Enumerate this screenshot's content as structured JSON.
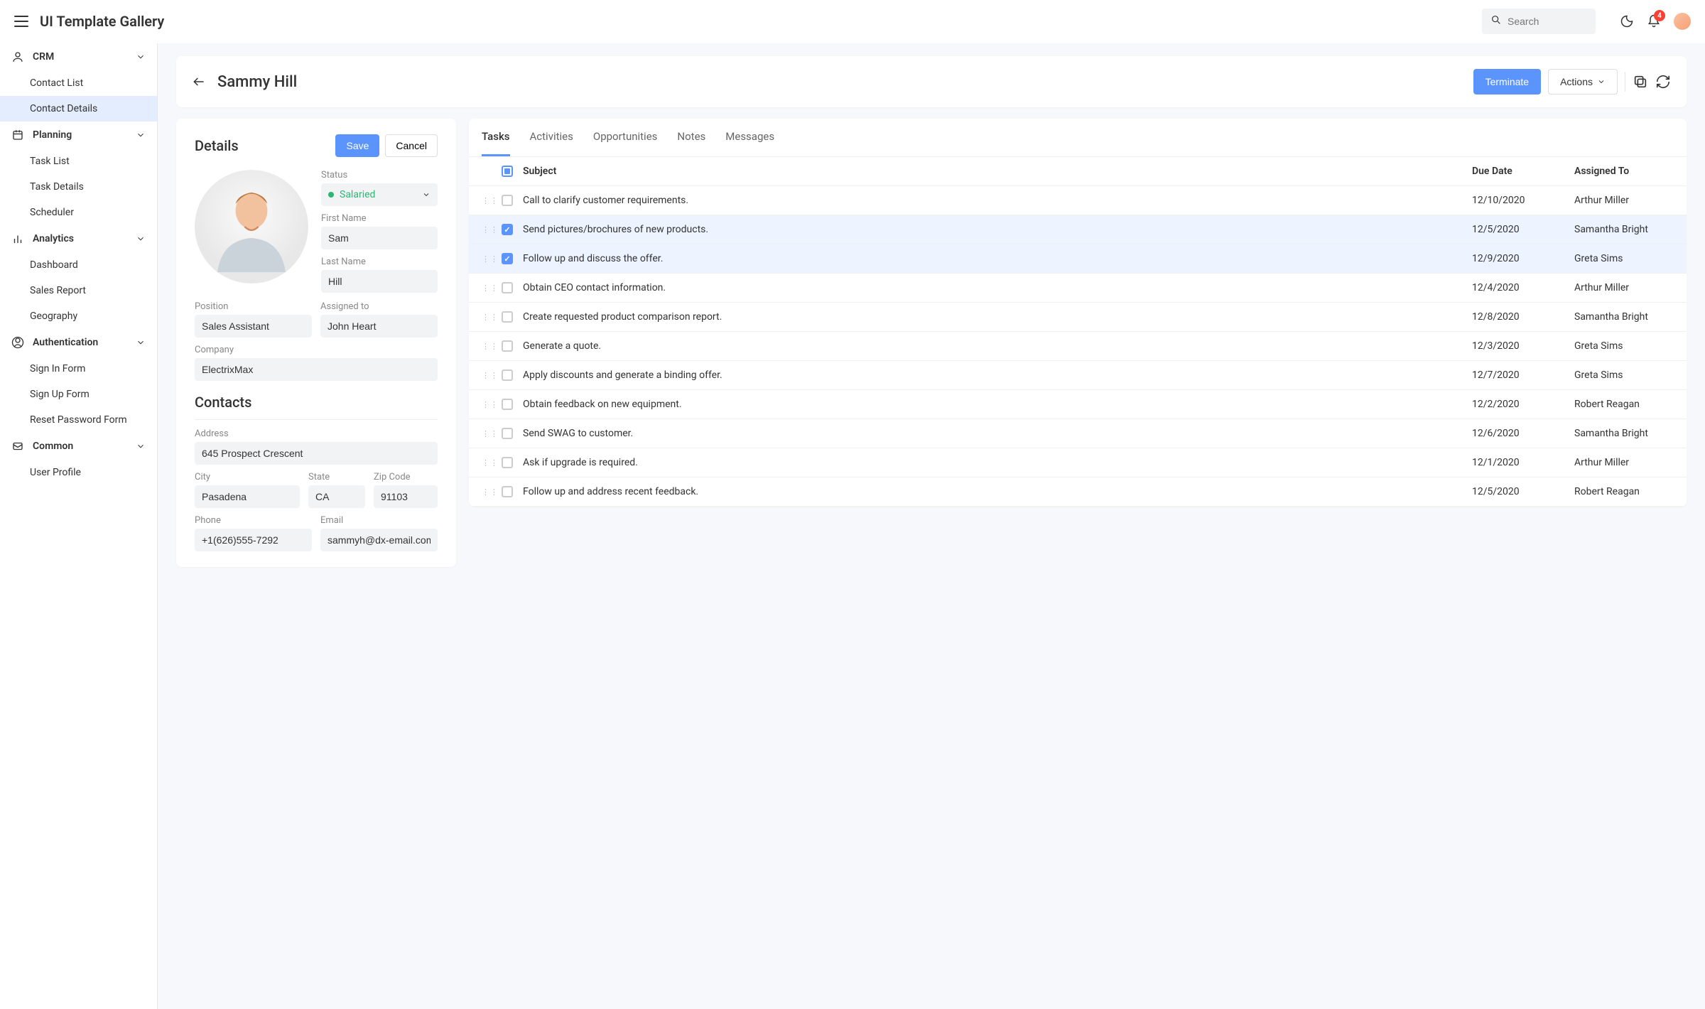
{
  "header": {
    "app_title": "UI Template Gallery",
    "search_placeholder": "Search",
    "notification_count": "4"
  },
  "sidebar": [
    {
      "title": "CRM",
      "items": [
        "Contact List",
        "Contact Details"
      ],
      "active_item": "Contact Details"
    },
    {
      "title": "Planning",
      "items": [
        "Task List",
        "Task Details",
        "Scheduler"
      ]
    },
    {
      "title": "Analytics",
      "items": [
        "Dashboard",
        "Sales Report",
        "Geography"
      ]
    },
    {
      "title": "Authentication",
      "items": [
        "Sign In Form",
        "Sign Up Form",
        "Reset Password Form"
      ]
    },
    {
      "title": "Common",
      "items": [
        "User Profile"
      ]
    }
  ],
  "titlebar": {
    "page_name": "Sammy Hill",
    "terminate": "Terminate",
    "actions": "Actions"
  },
  "details": {
    "title": "Details",
    "save": "Save",
    "cancel": "Cancel",
    "labels": {
      "status": "Status",
      "first_name": "First Name",
      "last_name": "Last Name",
      "position": "Position",
      "assigned_to": "Assigned to",
      "company": "Company",
      "contacts_section": "Contacts",
      "address": "Address",
      "city": "City",
      "state": "State",
      "zip": "Zip Code",
      "phone": "Phone",
      "email": "Email"
    },
    "values": {
      "status": "Salaried",
      "first_name": "Sam",
      "last_name": "Hill",
      "position": "Sales Assistant",
      "assigned_to": "John Heart",
      "company": "ElectrixMax",
      "address": "645 Prospect Crescent",
      "city": "Pasadena",
      "state": "CA",
      "zip": "91103",
      "phone": "+1(626)555-7292",
      "email": "sammyh@dx-email.com"
    }
  },
  "tabs": [
    "Tasks",
    "Activities",
    "Opportunities",
    "Notes",
    "Messages"
  ],
  "active_tab": "Tasks",
  "tasks": {
    "columns": {
      "subject": "Subject",
      "due": "Due Date",
      "assigned": "Assigned To"
    },
    "rows": [
      {
        "checked": false,
        "subject": "Call to clarify customer requirements.",
        "due": "12/10/2020",
        "assigned": "Arthur Miller"
      },
      {
        "checked": true,
        "subject": "Send pictures/brochures of new products.",
        "due": "12/5/2020",
        "assigned": "Samantha Bright"
      },
      {
        "checked": true,
        "subject": "Follow up and discuss the offer.",
        "due": "12/9/2020",
        "assigned": "Greta Sims"
      },
      {
        "checked": false,
        "subject": "Obtain CEO contact information.",
        "due": "12/4/2020",
        "assigned": "Arthur Miller"
      },
      {
        "checked": false,
        "subject": "Create requested product comparison report.",
        "due": "12/8/2020",
        "assigned": "Samantha Bright"
      },
      {
        "checked": false,
        "subject": "Generate a quote.",
        "due": "12/3/2020",
        "assigned": "Greta Sims"
      },
      {
        "checked": false,
        "subject": "Apply discounts and generate a binding offer.",
        "due": "12/7/2020",
        "assigned": "Greta Sims"
      },
      {
        "checked": false,
        "subject": "Obtain feedback on new equipment.",
        "due": "12/2/2020",
        "assigned": "Robert Reagan"
      },
      {
        "checked": false,
        "subject": "Send SWAG to customer.",
        "due": "12/6/2020",
        "assigned": "Samantha Bright"
      },
      {
        "checked": false,
        "subject": "Ask if upgrade is required.",
        "due": "12/1/2020",
        "assigned": "Arthur Miller"
      },
      {
        "checked": false,
        "subject": "Follow up and address recent feedback.",
        "due": "12/5/2020",
        "assigned": "Robert Reagan"
      }
    ]
  }
}
